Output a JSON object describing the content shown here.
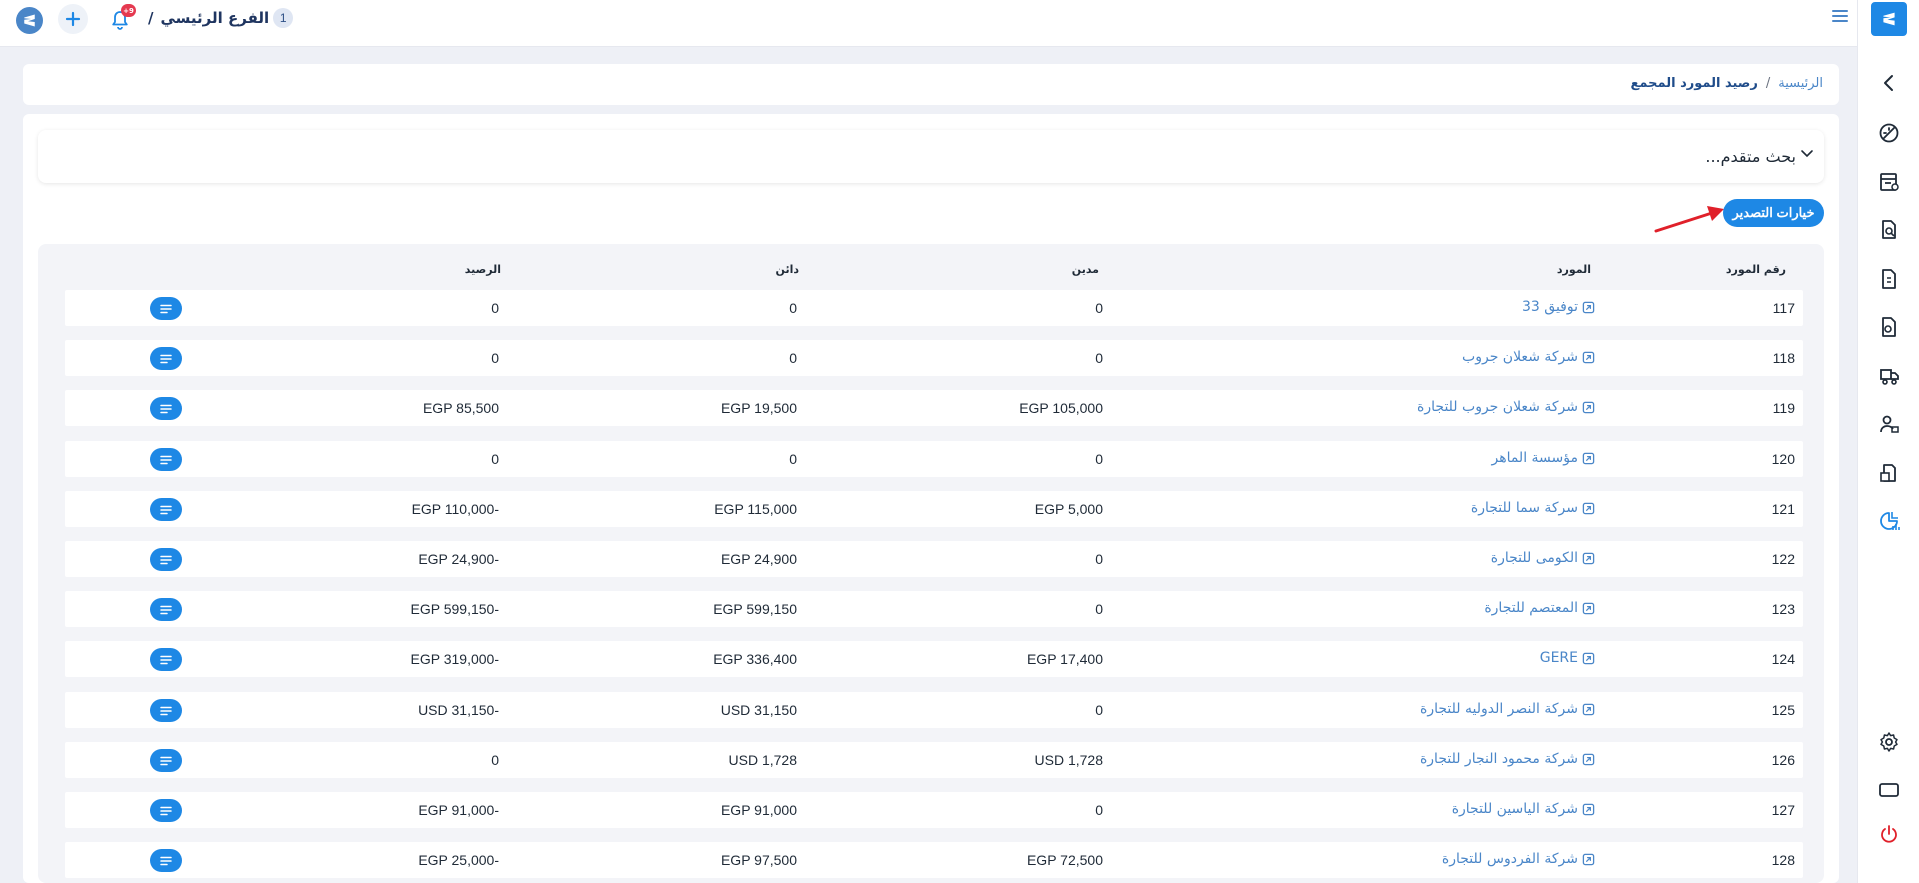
{
  "header": {
    "branch_number": "1",
    "branch_name": "الفرع الرئيسي",
    "branch_separator": "/",
    "notification_count": "+9"
  },
  "breadcrumb": {
    "home": "الرئيسية",
    "separator": "/",
    "current": "رصيد المورد المجمع"
  },
  "advanced_search": {
    "label": "بحث متقدم..."
  },
  "export_button": {
    "label": "خيارات التصدير"
  },
  "table": {
    "columns": {
      "supplier_no": "رقم المورد",
      "supplier": "المورد",
      "debit": "مدين",
      "credit": "دائن",
      "balance": "الرصيد"
    },
    "rows": [
      {
        "no": "117",
        "supplier": "توفيق 33",
        "debit": "0",
        "credit": "0",
        "balance": "0"
      },
      {
        "no": "118",
        "supplier": "شركة شعلان جروب",
        "debit": "0",
        "credit": "0",
        "balance": "0"
      },
      {
        "no": "119",
        "supplier": "شركة شعلان جروب للتجارة",
        "debit": "EGP 105,000",
        "credit": "EGP 19,500",
        "balance": "EGP 85,500"
      },
      {
        "no": "120",
        "supplier": "مؤسسة الماهر",
        "debit": "0",
        "credit": "0",
        "balance": "0"
      },
      {
        "no": "121",
        "supplier": "سركة سما للتجارة",
        "debit": "EGP 5,000",
        "credit": "EGP 115,000",
        "balance": "EGP 110,000-"
      },
      {
        "no": "122",
        "supplier": "الكومى للتجارة",
        "debit": "0",
        "credit": "EGP 24,900",
        "balance": "EGP 24,900-"
      },
      {
        "no": "123",
        "supplier": "المعتصم للتجارة",
        "debit": "0",
        "credit": "EGP 599,150",
        "balance": "EGP 599,150-"
      },
      {
        "no": "124",
        "supplier": "GERE",
        "debit": "EGP 17,400",
        "credit": "EGP 336,400",
        "balance": "EGP 319,000-"
      },
      {
        "no": "125",
        "supplier": "شركة النصر الدوليه للتجارة",
        "debit": "0",
        "credit": "USD 31,150",
        "balance": "USD 31,150-"
      },
      {
        "no": "126",
        "supplier": "شركة محمود النجار للتجارة",
        "debit": "USD 1,728",
        "credit": "USD 1,728",
        "balance": "0"
      },
      {
        "no": "127",
        "supplier": "شركة الياسين للتجارة",
        "debit": "0",
        "credit": "EGP 91,000",
        "balance": "EGP 91,000-"
      },
      {
        "no": "128",
        "supplier": "شركة الفردوس للتجارة",
        "debit": "EGP 72,500",
        "credit": "EGP 97,500",
        "balance": "EGP 25,000-"
      }
    ]
  },
  "colors": {
    "primary": "#1e88e5",
    "link": "#4a86c8",
    "badge": "#e53950",
    "annotation_arrow": "#e0202a"
  }
}
